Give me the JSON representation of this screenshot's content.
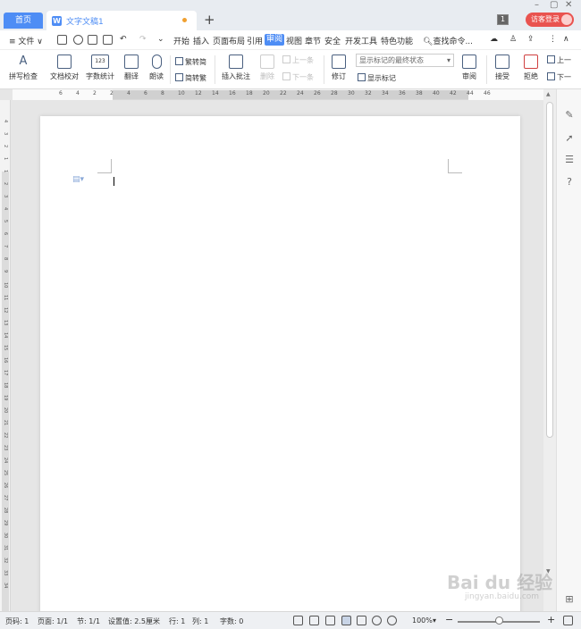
{
  "tabs": {
    "home": "首页",
    "doc_icon": "W",
    "doc_name": "文字文稿1",
    "add": "+"
  },
  "window": {
    "minimize": "–",
    "restore": "▢",
    "close": "✕",
    "badge": "1",
    "login": "访客登录"
  },
  "menu": {
    "file": "≡ 文件 ∨",
    "items": [
      "开始",
      "插入",
      "页面布局",
      "引用",
      "审阅",
      "视图",
      "章节",
      "安全",
      "开发工具",
      "特色功能"
    ],
    "active_index": 4,
    "search": "查找命令..."
  },
  "ribbon": {
    "spellcheck": "拼写检查",
    "proofread": "文档校对",
    "wordcount": "字数统计",
    "translate": "翻译",
    "read": "朗读",
    "to_traditional": "繁转简",
    "to_simplified": "简转繁",
    "insert_comment": "插入批注",
    "delete": "删除",
    "prev": "上一条",
    "next": "下一条",
    "revise": "修订",
    "display_state": "显示标记的最终状态",
    "show_markup": "显示标记",
    "review": "审阅",
    "accept": "接受",
    "reject": "拒绝",
    "prev_change": "上一",
    "next_change": "下一"
  },
  "ruler": {
    "ticks": [
      "6",
      "4",
      "2",
      "2",
      "4",
      "6",
      "8",
      "10",
      "12",
      "14",
      "16",
      "18",
      "20",
      "22",
      "24",
      "26",
      "28",
      "30",
      "32",
      "34",
      "36",
      "38",
      "40",
      "42",
      "44",
      "46"
    ]
  },
  "vruler_ticks": [
    "4",
    "3",
    "2",
    "1",
    "1",
    "2",
    "3",
    "4",
    "5",
    "6",
    "7",
    "8",
    "9",
    "10",
    "11",
    "12",
    "13",
    "14",
    "15",
    "16",
    "17",
    "18",
    "19",
    "20",
    "21",
    "22",
    "23",
    "24",
    "25",
    "26",
    "27",
    "28",
    "29",
    "30",
    "31",
    "32",
    "33",
    "34"
  ],
  "status": {
    "page_no": "页码: 1",
    "pages": "页面: 1/1",
    "section": "节: 1/1",
    "setting": "设置值: 2.5厘米",
    "row": "行: 1",
    "col": "列: 1",
    "chars": "字数: 0",
    "zoom": "100%",
    "zoom_minus": "−",
    "zoom_plus": "+"
  },
  "watermark": {
    "brand": "Bai du 经验",
    "url": "jingyan.baidu.com"
  }
}
